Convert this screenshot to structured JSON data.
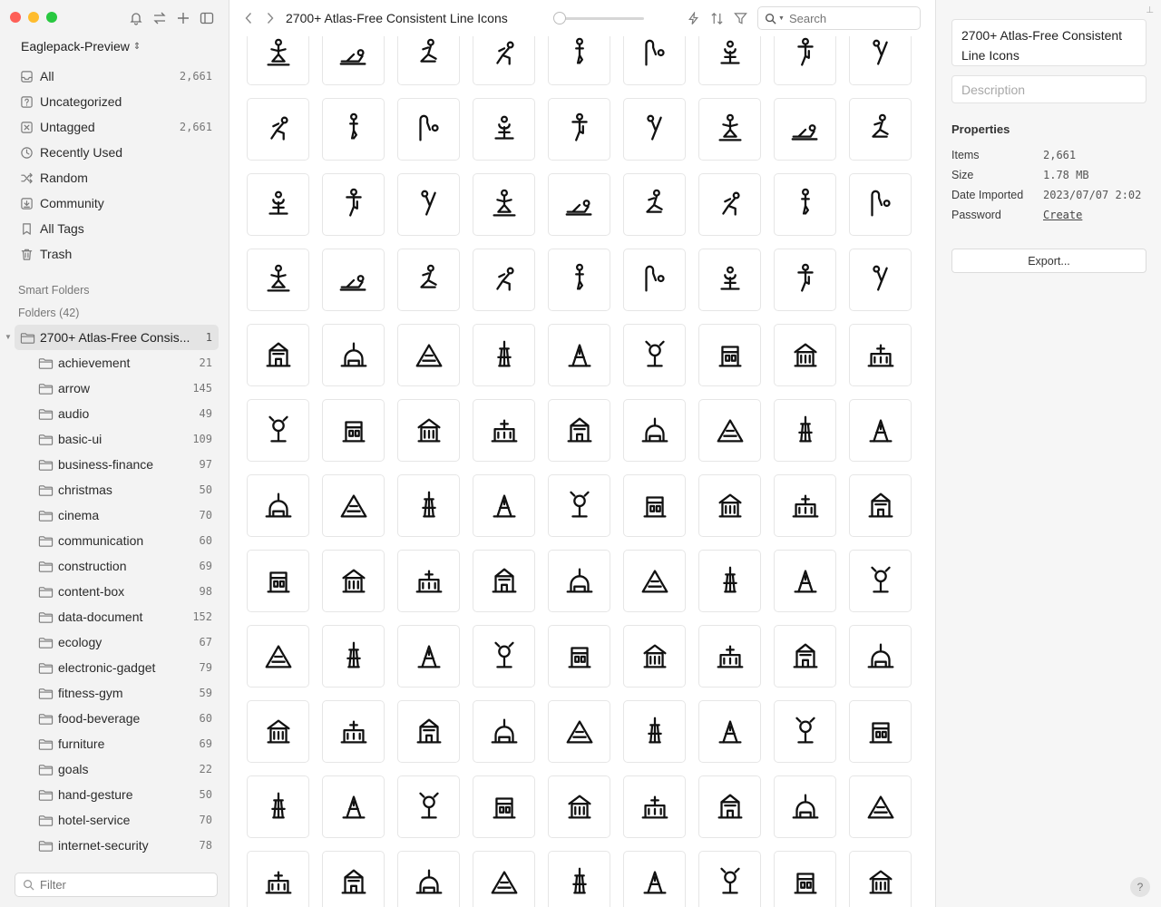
{
  "window": {
    "traffic_lights": {
      "close_color": "#fe5f57",
      "minimize_color": "#febc2e",
      "zoom_color": "#28c840"
    }
  },
  "sidebar": {
    "library_name": "Eaglepack-Preview",
    "library_chevron": "⌃⌄",
    "top_icons": [
      "bell-icon",
      "swap-icon",
      "plus-icon",
      "sidebar-toggle-icon"
    ],
    "nav": [
      {
        "label": "All",
        "count": "2,661",
        "icon": "all-icon",
        "active": false
      },
      {
        "label": "Uncategorized",
        "count": "",
        "icon": "uncategorized-icon"
      },
      {
        "label": "Untagged",
        "count": "2,661",
        "icon": "untagged-icon"
      },
      {
        "label": "Recently Used",
        "count": "",
        "icon": "clock-icon"
      },
      {
        "label": "Random",
        "count": "",
        "icon": "shuffle-icon"
      },
      {
        "label": "Community",
        "count": "",
        "icon": "community-icon"
      },
      {
        "label": "All Tags",
        "count": "",
        "icon": "bookmark-icon"
      },
      {
        "label": "Trash",
        "count": "",
        "icon": "trash-icon"
      }
    ],
    "smart_folders_label": "Smart Folders",
    "folders_label": "Folders (42)",
    "root_folder": {
      "label": "2700+ Atlas-Free Consis...",
      "count": "1"
    },
    "folders": [
      {
        "label": "achievement",
        "count": "21"
      },
      {
        "label": "arrow",
        "count": "145"
      },
      {
        "label": "audio",
        "count": "49"
      },
      {
        "label": "basic-ui",
        "count": "109"
      },
      {
        "label": "business-finance",
        "count": "97"
      },
      {
        "label": "christmas",
        "count": "50"
      },
      {
        "label": "cinema",
        "count": "70"
      },
      {
        "label": "communication",
        "count": "60"
      },
      {
        "label": "construction",
        "count": "69"
      },
      {
        "label": "content-box",
        "count": "98"
      },
      {
        "label": "data-document",
        "count": "152"
      },
      {
        "label": "ecology",
        "count": "67"
      },
      {
        "label": "electronic-gadget",
        "count": "79"
      },
      {
        "label": "fitness-gym",
        "count": "59"
      },
      {
        "label": "food-beverage",
        "count": "60"
      },
      {
        "label": "furniture",
        "count": "69"
      },
      {
        "label": "goals",
        "count": "22"
      },
      {
        "label": "hand-gesture",
        "count": "50"
      },
      {
        "label": "hotel-service",
        "count": "70"
      },
      {
        "label": "internet-security",
        "count": "78"
      }
    ],
    "filter_placeholder": "Filter"
  },
  "toolbar": {
    "title": "2700+ Atlas-Free Consistent Line Icons",
    "zoom_slider_value": 0,
    "tools": [
      "lightning-icon",
      "sort-icon",
      "filter-icon"
    ],
    "search_placeholder": "Search"
  },
  "grid": {
    "rows": [
      [
        "yoga-seated-icon",
        "yoga-lying-icon",
        "yoga-twist-icon",
        "yoga-lunge-icon",
        "yoga-standing-icon",
        "yoga-bend-icon",
        "yoga-meditate-icon",
        "yoga-tree-icon",
        "yoga-backbend-icon"
      ],
      [
        "yoga-chair-icon",
        "yoga-squat-icon",
        "yoga-lotus-icon",
        "yoga-kneel-icon",
        "yoga-sit-icon",
        "yoga-rest-icon",
        "yoga-flat-icon",
        "yoga-plank-icon",
        "yoga-warrior-icon"
      ],
      [
        "yoga-dancer-icon",
        "yoga-cobra-icon",
        "yoga-pigeon-icon",
        "yoga-boat-icon",
        "yoga-headstand-icon",
        "yoga-handstand-icon",
        "yoga-crow-icon",
        "yoga-star-icon",
        "yoga-balance-icon"
      ],
      [
        "yoga-downdog-icon",
        "yoga-side-icon",
        "yoga-table-icon",
        "yoga-wheel-icon",
        "yoga-forward-icon",
        "yoga-incline-icon",
        "yoga-roll-icon",
        "yoga-swing-icon",
        "yoga-arch-icon"
      ],
      [
        "statue-icon",
        "windmill-icon",
        "capitol-icon",
        "obelisk-icon",
        "museum-icon",
        "towers-icon",
        "chrysler-icon",
        "eiffel-icon",
        "cathedral-icon"
      ],
      [
        "palace-icon",
        "pagoda-icon",
        "taj-mahal-icon",
        "stonehenge-icon",
        "kremlin-icon",
        "buddha-head-icon",
        "space-needle-icon",
        "sagrada-icon",
        "castle-icon"
      ],
      [
        "pyramid-icon",
        "skyscraper-icon",
        "tv-tower-icon",
        "opera-house-icon",
        "gate-icon",
        "sun-temple-icon",
        "fuji-icon",
        "building-icon",
        "louvre-icon"
      ],
      [
        "ferris-wheel-icon",
        "pisa-icon",
        "tent-temple-icon",
        "liberty-icon",
        "christ-icon",
        "stupa-icon",
        "tower-pagoda-icon",
        "dome-icon",
        "great-wall-icon"
      ],
      [
        "buddha-icon",
        "mosque-icon",
        "bridge-icon",
        "arch-gate-icon",
        "temple-icon",
        "monument-icon",
        "eiffel-alt-icon",
        "moai-icon",
        "globe-icon"
      ],
      [
        "colosseum-icon",
        "cn-tower-icon",
        "city-icon",
        "burj-icon",
        "bell-tower-icon",
        "chinese-temple-icon",
        "golden-gate-icon",
        "tower-bridge-icon",
        "brandenburg-icon"
      ],
      [
        "lighthouse-icon",
        "pagoda-tall-icon",
        "torii-icon",
        "forbidden-city-icon",
        "bell-gate-icon",
        "arc-triomphe-icon",
        "speaker-people-icon",
        "team-star-icon",
        "team-up-icon"
      ],
      [
        "team-swap-icon",
        "like-hand-icon",
        "group-icon",
        "team-work-icon",
        "meeting-icon",
        "team-circle-icon",
        "global-team-icon",
        "home-team-icon",
        "partners-icon"
      ]
    ]
  },
  "panel": {
    "pin_glyph": "⊥",
    "name": "2700+ Atlas-Free Consistent Line Icons",
    "description_placeholder": "Description",
    "properties_title": "Properties",
    "properties": [
      {
        "key": "Items",
        "value": "2,661"
      },
      {
        "key": "Size",
        "value": "1.78 MB"
      },
      {
        "key": "Date Imported",
        "value": "2023/07/07 2:02"
      },
      {
        "key": "Password",
        "value": "Create",
        "link": true
      }
    ],
    "export_label": "Export...",
    "help_label": "?"
  }
}
